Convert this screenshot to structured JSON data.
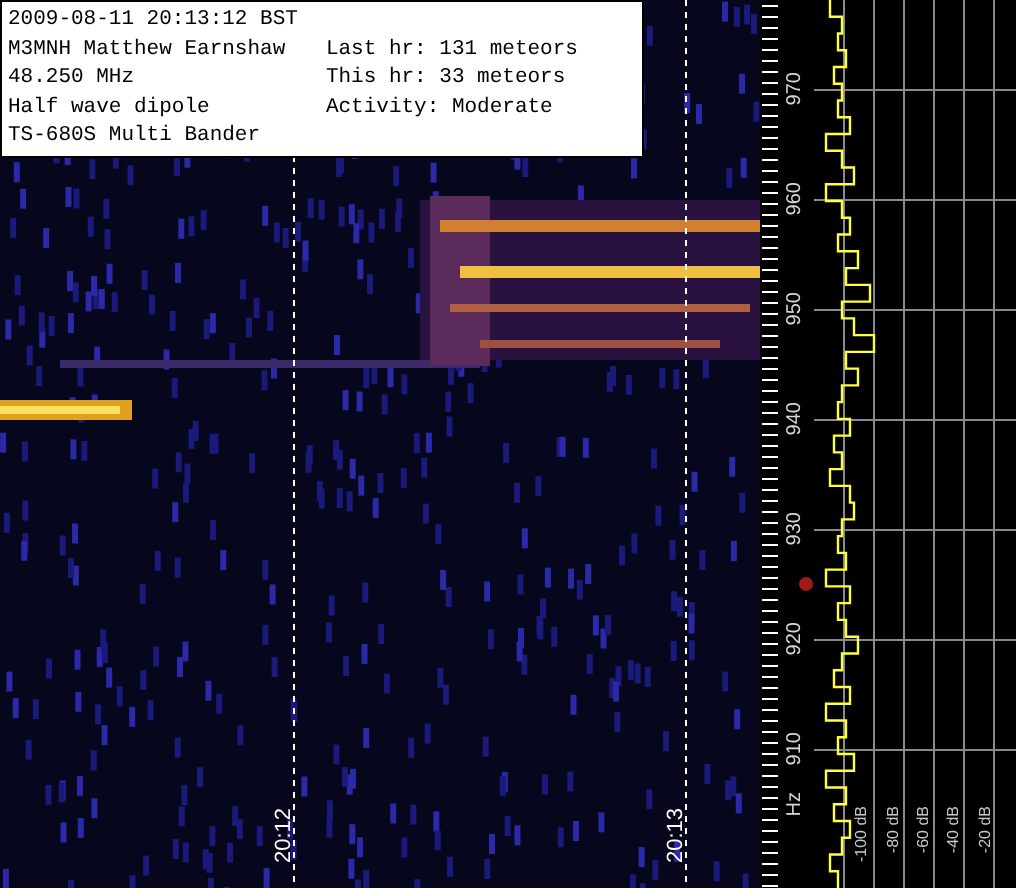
{
  "info": {
    "left_lines": [
      "2009-08-11 20:13:12 BST",
      "M3MNH Matthew Earnshaw",
      "48.250 MHz",
      "Half wave dipole",
      "TS-680S Multi Bander"
    ],
    "right_lines": [
      "Last hr: 131 meteors",
      "This hr: 33 meteors",
      "Activity: Moderate"
    ]
  },
  "time_markers": [
    "20:12",
    "20:13"
  ],
  "frequency_labels": [
    "970",
    "960",
    "950",
    "940",
    "930",
    "920",
    "910"
  ],
  "frequency_unit": "Hz",
  "power_labels": [
    "-100 dB",
    "-80 dB",
    "-60 dB",
    "-40 dB",
    "-20 dB"
  ]
}
